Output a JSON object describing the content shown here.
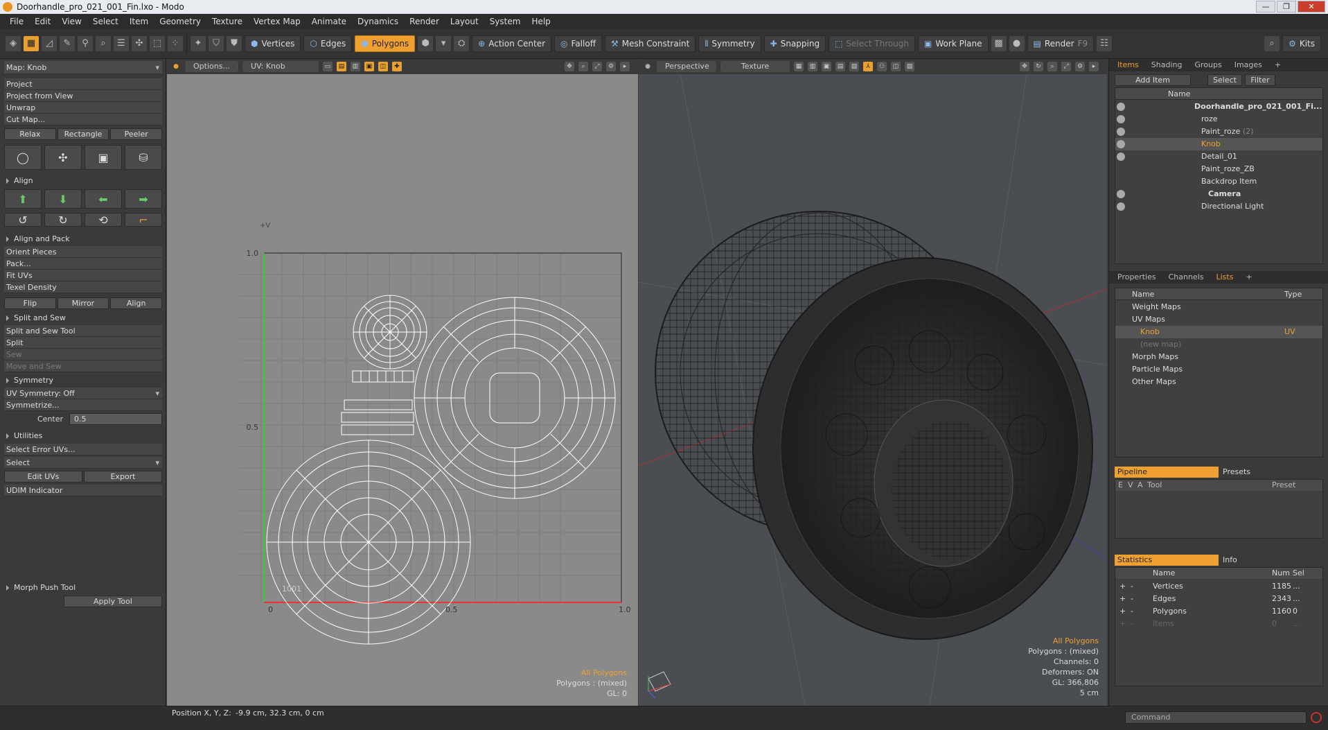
{
  "window": {
    "title": "Doorhandle_pro_021_001_Fin.lxo - Modo",
    "controls": [
      "—",
      "❐",
      "✕"
    ]
  },
  "menu": [
    "File",
    "Edit",
    "View",
    "Select",
    "Item",
    "Geometry",
    "Texture",
    "Vertex Map",
    "Animate",
    "Dynamics",
    "Render",
    "Layout",
    "System",
    "Help"
  ],
  "toolbar": {
    "vertices": "Vertices",
    "edges": "Edges",
    "polygons": "Polygons",
    "action_center": "Action Center",
    "falloff": "Falloff",
    "mesh_constraint": "Mesh Constraint",
    "symmetry": "Symmetry",
    "snapping": "Snapping",
    "select_through": "Select Through",
    "work_plane": "Work Plane",
    "render": "Render",
    "render_key": "F9",
    "kits": "Kits"
  },
  "left": {
    "map": "Map: Knob",
    "project_items": [
      "Project",
      "Project from View",
      "Unwrap",
      "Cut Map..."
    ],
    "relax_row": [
      "Relax",
      "Rectangle",
      "Peeler"
    ],
    "align_head": "Align",
    "align_pack_head": "Align and Pack",
    "align_pack_items": [
      "Orient Pieces",
      "Pack...",
      "Fit UVs",
      "Texel Density"
    ],
    "flip_row": [
      "Flip",
      "Mirror",
      "Align"
    ],
    "split_head": "Split and Sew",
    "split_items": [
      "Split and Sew Tool",
      "Split",
      "Sew",
      "Move and Sew"
    ],
    "symmetry_head": "Symmetry",
    "uv_symmetry": "UV Symmetry: Off",
    "symmetrize": "Symmetrize...",
    "center_label": "Center",
    "center_value": "0.5",
    "utilities_head": "Utilities",
    "select_error": "Select Error UVs...",
    "select": "Select",
    "edit_uvs": "Edit UVs",
    "export": "Export",
    "udim": "UDIM Indicator",
    "morph_push": "Morph Push Tool",
    "apply_tool": "Apply Tool"
  },
  "uv": {
    "options": "Options...",
    "uv_tab": "UV: Knob",
    "v_label": "+V",
    "tick_1": "1.0",
    "tick_05": "0.5",
    "tick_0": "0",
    "tick_x05": "0.5",
    "tick_x1": "1.0",
    "udim": "1001",
    "info_all": "All Polygons",
    "info_polys": "Polygons : (mixed)",
    "info_gl": "GL: 0"
  },
  "view3d": {
    "perspective": "Perspective",
    "texture": "Texture",
    "info": [
      "All Polygons",
      "Polygons : (mixed)",
      "Channels: 0",
      "Deformers: ON",
      "GL: 366,806",
      "5 cm"
    ]
  },
  "items": {
    "tabs": [
      "Items",
      "Shading",
      "Groups",
      "Images"
    ],
    "add_item": "Add Item",
    "select": "Select",
    "filter": "Filter",
    "name_col": "Name",
    "rows": [
      {
        "name": "Doorhandle_pro_021_001_Fi...",
        "extra": ""
      },
      {
        "name": "roze",
        "extra": ""
      },
      {
        "name": "Paint_roze",
        "extra": "(2)"
      },
      {
        "name": "Knob",
        "extra": ""
      },
      {
        "name": "Detail_01",
        "extra": ""
      },
      {
        "name": "Paint_roze_ZB",
        "extra": ""
      },
      {
        "name": "Backdrop Item",
        "extra": ""
      },
      {
        "name": "Camera",
        "extra": ""
      },
      {
        "name": "Directional Light",
        "extra": ""
      }
    ]
  },
  "lists": {
    "tabs": [
      "Properties",
      "Channels",
      "Lists"
    ],
    "name_col": "Name",
    "type_col": "Type",
    "rows": [
      "Weight Maps",
      "UV Maps",
      "Knob",
      "(new map)",
      "Morph Maps",
      "Particle Maps",
      "Other Maps"
    ],
    "knob_type": "UV"
  },
  "pipeline": {
    "tab": "Pipeline",
    "presets": "Presets",
    "cols": [
      "E",
      "V",
      "A",
      "Tool",
      "Preset"
    ]
  },
  "stats": {
    "tab": "Statistics",
    "info": "Info",
    "name_col": "Name",
    "num_col": "Num",
    "sel_col": "Sel",
    "rows": [
      {
        "name": "Vertices",
        "num": "1185",
        "sel": "..."
      },
      {
        "name": "Edges",
        "num": "2343",
        "sel": "..."
      },
      {
        "name": "Polygons",
        "num": "1160",
        "sel": "0"
      },
      {
        "name": "Items",
        "num": "0",
        "sel": "..."
      }
    ]
  },
  "status": {
    "position_label": "Position X, Y, Z:",
    "position_value": "-9.9 cm, 32.3 cm, 0 cm",
    "command": "Command"
  }
}
